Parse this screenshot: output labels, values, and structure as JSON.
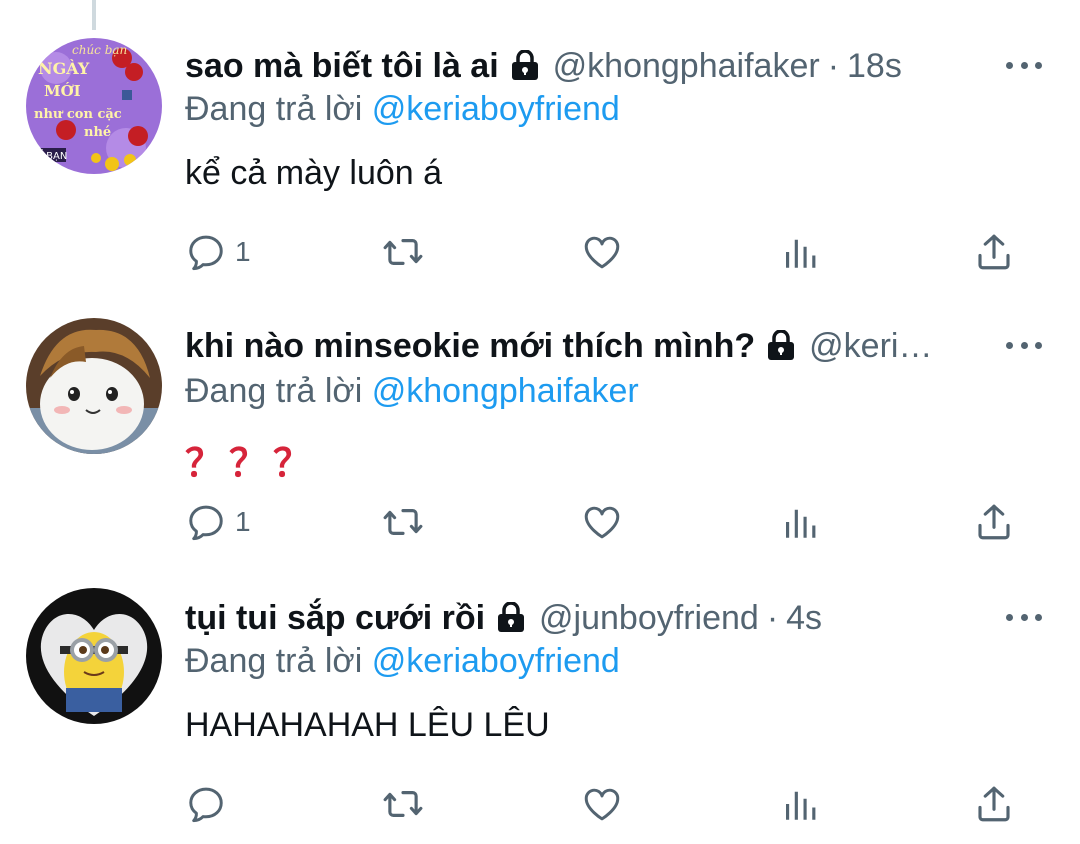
{
  "tweets": [
    {
      "display_name": "sao mà biết tôi là ai",
      "handle": "@khongphaifaker",
      "separator": "·",
      "time": "18s",
      "reply_prefix": "Đang trả lời",
      "reply_mention": "@keriaboyfriend",
      "text": "kể cả mày luôn á",
      "reply_count": "1",
      "avatar_text": {
        "line1": "chúc bạn",
        "line2": "NGÀY",
        "line3": "MỚI",
        "line4": "như con cặc",
        "line5": "nhé",
        "line6": "MẾ BẠN"
      }
    },
    {
      "display_name": "khi nào minseokie mới thích mình?",
      "handle": "@keriabo…",
      "separator": "",
      "time": "",
      "reply_prefix": "Đang trả lời",
      "reply_mention": "@khongphaifaker",
      "text": "？？？",
      "reply_count": "1"
    },
    {
      "display_name": "tụi tui sắp cưới rồi",
      "handle": "@junboyfriend",
      "separator": "·",
      "time": "4s",
      "reply_prefix": "Đang trả lời",
      "reply_mention": "@keriaboyfriend",
      "text": "HAHAHAHAH LÊU LÊU",
      "reply_count": ""
    }
  ],
  "icons": {
    "lock": "lock-icon",
    "more": "more-icon",
    "reply": "reply-icon",
    "retweet": "retweet-icon",
    "like": "heart-icon",
    "views": "views-icon",
    "share": "share-icon"
  },
  "colors": {
    "text": "#0f1419",
    "secondary": "#536471",
    "link": "#1d9bf0",
    "thread_line": "#cfd9de",
    "question_marks": "#d6243a"
  }
}
